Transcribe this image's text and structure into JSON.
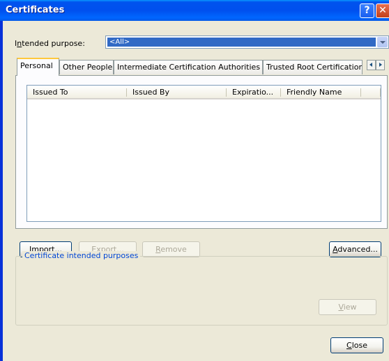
{
  "window": {
    "title": "Certificates"
  },
  "purpose": {
    "label_pre": "I",
    "label_key": "n",
    "label_post": "tended purpose:",
    "value": "<All>"
  },
  "tabs": [
    {
      "label": "Personal"
    },
    {
      "label": "Other People"
    },
    {
      "label": "Intermediate Certification Authorities"
    },
    {
      "label": "Trusted Root Certification"
    }
  ],
  "columns": [
    {
      "label": "Issued To"
    },
    {
      "label": "Issued By"
    },
    {
      "label": "Expiratio..."
    },
    {
      "label": "Friendly Name"
    }
  ],
  "buttons": {
    "import": {
      "key": "I",
      "rest": "mport..."
    },
    "export": {
      "key": "E",
      "rest": "xport..."
    },
    "remove": {
      "key": "R",
      "rest": "emove"
    },
    "advanced": {
      "key": "A",
      "rest": "dvanced..."
    },
    "view": {
      "key": "V",
      "rest": "iew"
    },
    "close": {
      "key": "C",
      "rest": "lose"
    }
  },
  "group": {
    "label": "Certificate intended purposes"
  },
  "colors": {
    "title_bar": "#0054e3",
    "selection": "#316ac5",
    "dialog_bg": "#ece9d8",
    "tab_highlight": "#ffc83c"
  }
}
